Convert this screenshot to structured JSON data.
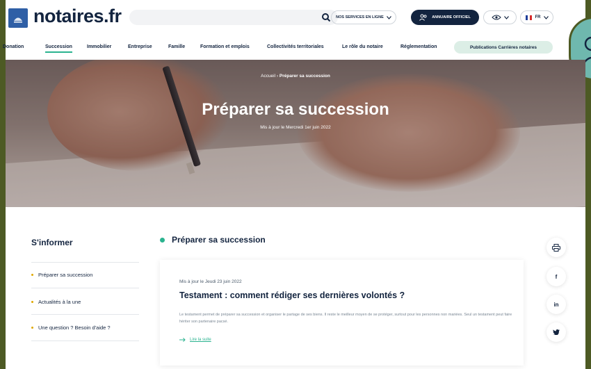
{
  "header": {
    "logo_text": "notaires.fr",
    "services_label": "NOS SERVICES EN LIGNE",
    "annuaire_label": "ANNUAIRE OFFICIEL",
    "lang_label": "FR"
  },
  "nav": {
    "items": [
      "Donation",
      "Succession",
      "Immobilier",
      "Entreprise",
      "Famille",
      "Formation et emplois",
      "Collectivités territoriales",
      "Le rôle du notaire",
      "Réglementation"
    ],
    "active": "Succession",
    "highlight": "Publications Carrières notaires"
  },
  "hero": {
    "breadcrumb_home": "Accueil",
    "breadcrumb_sep": "›",
    "breadcrumb_current": "Préparer sa succession",
    "title": "Préparer sa succession",
    "subtitle": "Mis à jour le Mercredi 1er juin 2022"
  },
  "sidebar": {
    "title": "S'informer",
    "items": [
      "Préparer sa succession",
      "Actualités à la une",
      "Une question ? Besoin d'aide ?"
    ]
  },
  "main": {
    "section_title": "Préparer sa succession",
    "card": {
      "date": "Mis à jour le Jeudi 23 juin 2022",
      "title": "Testament : comment rédiger ses dernières volontés ?",
      "text": "Le testament permet de préparer sa succession et organiser le partage de ses biens. Il reste le meilleur moyen de se protéger, surtout pour les personnes non mariées. Seul un testament peut faire hériter son partenaire pacsé.",
      "link": "Lire la suite"
    }
  },
  "share": {
    "facebook": "f",
    "linkedin": "in",
    "twitter": "t"
  },
  "colors": {
    "brand_navy": "#13243f",
    "accent_green": "#2ab38f",
    "bullet_yellow": "#e0a800"
  }
}
